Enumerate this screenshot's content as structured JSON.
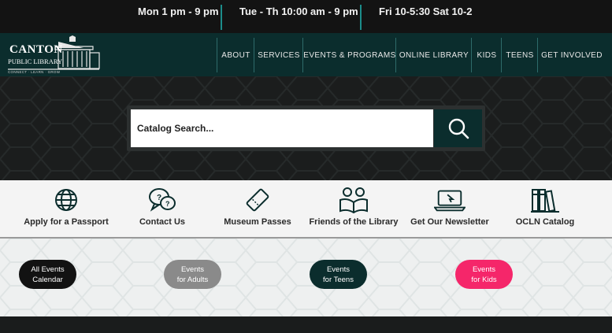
{
  "hours": [
    "Mon 1 pm - 9 pm",
    "Tue - Th 10:00 am - 9 pm",
    "Fri 10-5:30 Sat 10-2"
  ],
  "logo": {
    "name": "CANTON",
    "subtitle": "PUBLIC LIBRARY",
    "tagline": "CONNECT · LEARN · GROW"
  },
  "nav": [
    "ABOUT",
    "SERVICES",
    "EVENTS & PROGRAMS",
    "ONLINE LIBRARY",
    "KIDS",
    "TEENS",
    "GET INVOLVED"
  ],
  "search": {
    "placeholder": "Catalog Search...",
    "icon": "search-icon"
  },
  "quick_links": [
    {
      "label": "Apply for a Passport",
      "icon": "globe-icon"
    },
    {
      "label": "Contact Us",
      "icon": "chat-question-icon"
    },
    {
      "label": "Museum Passes",
      "icon": "ticket-icon"
    },
    {
      "label": "Friends of the Library",
      "icon": "readers-icon"
    },
    {
      "label": "Get Our Newsletter",
      "icon": "laptop-icon"
    },
    {
      "label": "OCLN Catalog",
      "icon": "books-icon"
    }
  ],
  "event_buttons": [
    {
      "line1": "All Events",
      "line2": "Calendar"
    },
    {
      "line1": "Events",
      "line2": "for Adults"
    },
    {
      "line1": "Events",
      "line2": "for Teens"
    },
    {
      "line1": "Events",
      "line2": "for Kids"
    }
  ],
  "colors": {
    "teal_dark": "#0b2d2d",
    "accent_teal": "#1c8c8a",
    "pink": "#f5266a",
    "gray": "#8a8a8a",
    "black": "#121212"
  }
}
